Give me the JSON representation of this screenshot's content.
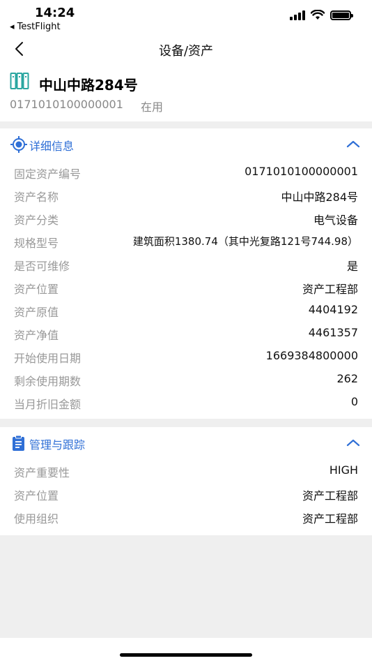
{
  "status_bar": {
    "time": "14:24",
    "back_app": "◂ TestFlight"
  },
  "nav": {
    "title": "设备/资产"
  },
  "asset": {
    "name": "中山中路284号",
    "code": "0171010100000001",
    "status": "在用"
  },
  "detail_section": {
    "title": "详细信息",
    "rows": [
      {
        "label": "固定资产编号",
        "value": "0171010100000001"
      },
      {
        "label": "资产名称",
        "value": "中山中路284号"
      },
      {
        "label": "资产分类",
        "value": "电气设备"
      },
      {
        "label": "规格型号",
        "value": "建筑面积1380.74（其中光复路121号744.98）"
      },
      {
        "label": "是否可维修",
        "value": "是"
      },
      {
        "label": "资产位置",
        "value": "资产工程部"
      },
      {
        "label": "资产原值",
        "value": "4404192"
      },
      {
        "label": "资产净值",
        "value": "4461357"
      },
      {
        "label": "开始使用日期",
        "value": "1669384800000"
      },
      {
        "label": "剩余使用期数",
        "value": "262"
      },
      {
        "label": "当月折旧金额",
        "value": "0"
      }
    ]
  },
  "manage_section": {
    "title": "管理与跟踪",
    "rows": [
      {
        "label": "资产重要性",
        "value": "HIGH"
      },
      {
        "label": "资产位置",
        "value": "资产工程部"
      },
      {
        "label": "使用组织",
        "value": "资产工程部"
      }
    ]
  },
  "colors": {
    "accent": "#2f6fd6",
    "asset_icon": "#2aa6a0",
    "label": "#999999",
    "background": "#efefef"
  },
  "icons": {
    "back": "chevron-left-icon",
    "asset": "asset-cabinet-icon",
    "detail": "target-icon",
    "manage": "clipboard-icon",
    "collapse": "chevron-up-icon"
  }
}
